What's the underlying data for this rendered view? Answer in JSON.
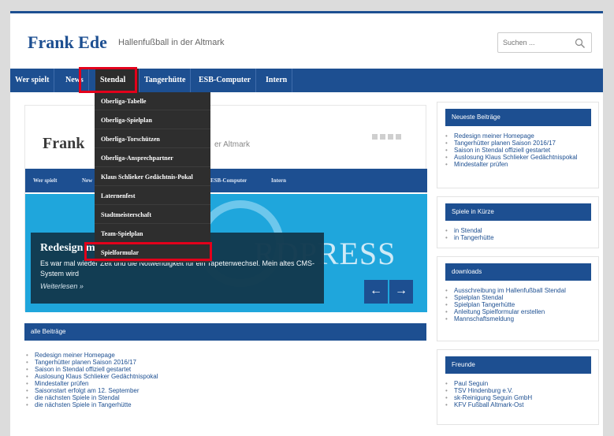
{
  "site": {
    "title": "Frank Ede",
    "tagline": "Hallenfußball in der Altmark"
  },
  "search": {
    "placeholder": "Suchen ..."
  },
  "nav": {
    "items": [
      {
        "label": "Wer spielt"
      },
      {
        "label": "News"
      },
      {
        "label": "Stendal"
      },
      {
        "label": "Tangerhütte"
      },
      {
        "label": "ESB-Computer"
      },
      {
        "label": "Intern"
      }
    ]
  },
  "dropdown": {
    "items": [
      {
        "label": "Oberliga-Tabelle"
      },
      {
        "label": "Oberliga-Spielplan"
      },
      {
        "label": "Oberliga-Torschützen"
      },
      {
        "label": "Oberliga-Ansprechpartner"
      },
      {
        "label": "Klaus Schlieker Gedächtnis-Pokal"
      },
      {
        "label": "Laternenfest"
      },
      {
        "label": "Stadtmeisterschaft"
      },
      {
        "label": "Team-Spielplan"
      },
      {
        "label": "Spielformular"
      }
    ]
  },
  "slider": {
    "inner_title": "Frank",
    "inner_desc": "er Altmark",
    "inner_nav": [
      "Wer spielt",
      "New",
      "ESB-Computer",
      "Intern"
    ],
    "wp_text": "RDPRESS",
    "caption_title": "Redesign meiner Homepage",
    "caption_text": "Es war mal wieder Zeit und die Notwendigkeit für ein Tapetenwechsel. Mein altes CMS-System wird",
    "read_more": "Weiterlesen »",
    "prev": "←",
    "next": "→"
  },
  "all_posts": {
    "title": "alle Beiträge",
    "items": [
      "Redesign meiner Homepage",
      "Tangerhütter planen Saison 2016/17",
      "Saison in Stendal offiziell gestartet",
      "Auslosung Klaus Schlieker Gedächtnispokal",
      "Mindestalter prüfen",
      "Saisonstart erfolgt am 12. September",
      "die nächsten Spiele in Stendal",
      "die nächsten Spiele in Tangerhütte"
    ]
  },
  "widgets": [
    {
      "title": "Neueste Beiträge",
      "items": [
        "Redesign meiner Homepage",
        "Tangerhütter planen Saison 2016/17",
        "Saison in Stendal offiziell gestartet",
        "Auslosung Klaus Schlieker Gedächtnispokal",
        "Mindestalter prüfen"
      ]
    },
    {
      "title": "Spiele in Kürze",
      "items": [
        "in Stendal",
        "in Tangerhütte"
      ]
    },
    {
      "title": "downloads",
      "items": [
        "Ausschreibung im Hallenfußball Stendal",
        "Spielplan Stendal",
        "Spielplan Tangerhütte",
        "Anleitung Spielformular erstellen",
        "Mannschaftsmeldung"
      ]
    },
    {
      "title": "Freunde",
      "items": [
        "Paul Seguin",
        "TSV Hindenburg e.V.",
        "sk-Reinigung Seguin GmbH",
        "KFV Fußball Altmark-Ost"
      ]
    }
  ],
  "colors": {
    "primary": "#1d4f91",
    "dropdown_bg": "#2e2e2e",
    "highlight": "#e3001b",
    "hero": "#1fa6dc"
  }
}
